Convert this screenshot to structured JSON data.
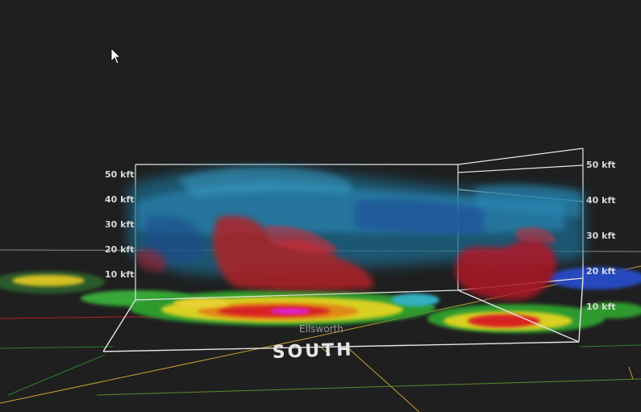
{
  "app": {
    "view": "3D radar volume render"
  },
  "left_axis_labels": [
    "50 kft",
    "40 kft",
    "30 kft",
    "20 kft",
    "10 kft"
  ],
  "right_axis_labels": [
    "50 kft",
    "40 kft",
    "30 kft",
    "20 kft",
    "10 kft"
  ],
  "map": {
    "city_label": "Ellsworth",
    "direction_label": "SOUTH"
  },
  "colors": {
    "background": "#1f1f1f",
    "box_lines": "#e6e6e6",
    "county_lines": "#c8a030",
    "volume_blue": "#2a7fb0",
    "volume_red": "#b02020"
  },
  "icons": [
    "mouse-cursor-icon"
  ]
}
